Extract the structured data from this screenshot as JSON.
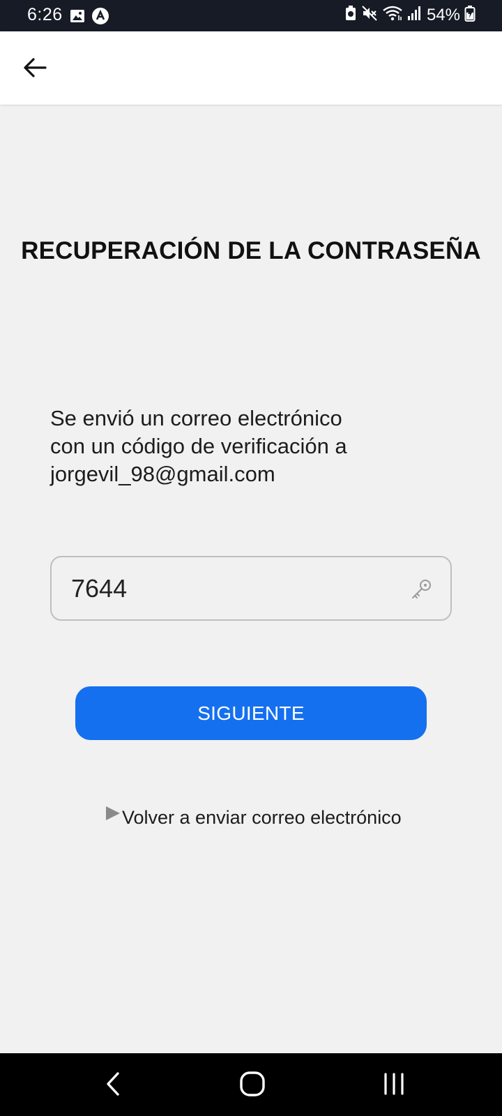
{
  "status_bar": {
    "time": "6:26",
    "battery": "54%",
    "icons": [
      "image-icon",
      "app-notification-icon",
      "battery-saver-icon",
      "mute-icon",
      "wifi-icon",
      "signal-icon",
      "battery-charging-icon"
    ]
  },
  "app_bar": {
    "back_icon": "arrow-left-icon"
  },
  "title": "RECUPERACIÓN DE LA CONTRASEÑA",
  "message": {
    "line1": "Se envió un correo electrónico",
    "line2": "con un código de verificación a",
    "email": "jorgevil_98@gmail.com"
  },
  "code_field": {
    "value": "7644",
    "icon": "key-icon"
  },
  "next_button": {
    "label": "SIGUIENTE",
    "color": "#1570ef"
  },
  "resend": {
    "label": "Volver a enviar correo electrónico",
    "icon": "play-icon"
  },
  "nav_bar": {
    "buttons": [
      "back",
      "home",
      "recents"
    ]
  }
}
